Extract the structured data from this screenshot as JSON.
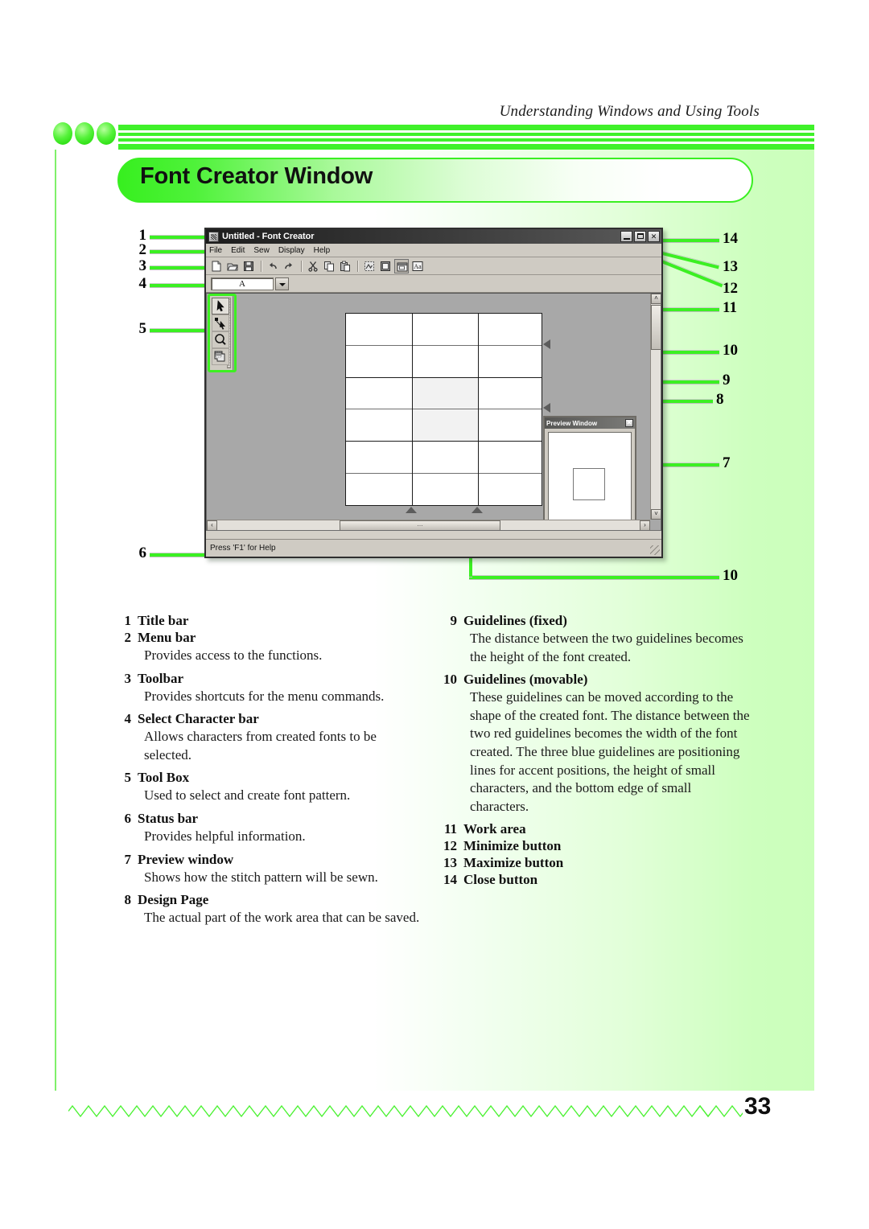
{
  "page": {
    "running_head": "Understanding Windows and Using Tools",
    "section_title": "Font Creator Window",
    "page_number": "33",
    "accent_color": "#3ff12a",
    "panel_gradient_end": "#cbffbb"
  },
  "app": {
    "title": "Untitled - Font Creator",
    "title_icon": "font-creator-app-icon",
    "window_buttons": [
      {
        "name": "minimize",
        "label": "–",
        "icon": "minimize-icon"
      },
      {
        "name": "maximize",
        "label": "□",
        "icon": "maximize-icon"
      },
      {
        "name": "close",
        "label": "✕",
        "icon": "close-icon"
      }
    ],
    "menus": [
      "File",
      "Edit",
      "Sew",
      "Display",
      "Help"
    ],
    "toolbar": [
      {
        "name": "new",
        "icon": "new-document-icon"
      },
      {
        "name": "open",
        "icon": "open-folder-icon"
      },
      {
        "name": "save",
        "icon": "save-disk-icon"
      },
      {
        "name": "sep1",
        "icon": "separator"
      },
      {
        "name": "undo",
        "icon": "undo-arrow-icon"
      },
      {
        "name": "redo",
        "icon": "redo-arrow-icon"
      },
      {
        "name": "sep2",
        "icon": "separator"
      },
      {
        "name": "cut",
        "icon": "scissors-icon"
      },
      {
        "name": "copy",
        "icon": "copy-icon"
      },
      {
        "name": "paste",
        "icon": "paste-icon"
      },
      {
        "name": "sep3",
        "icon": "separator"
      },
      {
        "name": "sew",
        "icon": "sew-icon"
      },
      {
        "name": "design-page-property",
        "icon": "design-page-icon"
      },
      {
        "name": "preview",
        "icon": "preview-icon"
      },
      {
        "name": "font-property",
        "icon": "font-aa-icon"
      }
    ],
    "select_character_bar": {
      "value": "A",
      "dropdown_icon": "chevron-down-icon"
    },
    "toolbox": [
      {
        "name": "select-tool",
        "icon": "arrow-pointer-icon",
        "active": true
      },
      {
        "name": "point-edit-tool",
        "icon": "point-edit-icon",
        "active": false
      },
      {
        "name": "zoom-tool",
        "icon": "magnifier-icon",
        "active": false
      },
      {
        "name": "pattern-tool",
        "icon": "pattern-stack-icon",
        "active": false
      }
    ],
    "preview_window": {
      "title": "Preview Window",
      "close_icon": "close-icon",
      "close_label": "✕"
    },
    "status_bar": "Press 'F1' for Help",
    "scrollbars": {
      "up_label": "˄",
      "down_label": "˅",
      "left_label": "‹",
      "right_label": "›",
      "grip_label": "⋯"
    }
  },
  "callouts": {
    "left": [
      "1",
      "2",
      "3",
      "4",
      "5",
      "6"
    ],
    "right": [
      "14",
      "13",
      "12",
      "11",
      "10",
      "9",
      "8",
      "7",
      "10"
    ]
  },
  "legend": {
    "left": [
      {
        "num": "1",
        "term": "Title bar",
        "desc": ""
      },
      {
        "num": "2",
        "term": "Menu bar",
        "desc": "Provides access to the functions."
      },
      {
        "num": "3",
        "term": "Toolbar",
        "desc": "Provides shortcuts for the menu commands."
      },
      {
        "num": "4",
        "term": "Select Character bar",
        "desc": "Allows characters from created fonts to be selected."
      },
      {
        "num": "5",
        "term": "Tool Box",
        "desc": "Used to select and create font pattern."
      },
      {
        "num": "6",
        "term": "Status bar",
        "desc": "Provides helpful information."
      },
      {
        "num": "7",
        "term": "Preview window",
        "desc": "Shows how the stitch pattern will be sewn."
      },
      {
        "num": "8",
        "term": "Design Page",
        "desc": "The actual part of the work area that can be saved."
      }
    ],
    "right": [
      {
        "num": "9",
        "term": "Guidelines (fixed)",
        "desc": "The distance between the two guidelines becomes the height of the font created."
      },
      {
        "num": "10",
        "term": "Guidelines (movable)",
        "desc": "These guidelines can be moved according to the shape of the created font. The distance between the two red guidelines becomes the width of the font created. The three blue guidelines are positioning lines for accent positions, the height of small characters, and the bottom edge of small characters."
      },
      {
        "num": "11",
        "term": "Work area",
        "desc": ""
      },
      {
        "num": "12",
        "term": "Minimize button",
        "desc": ""
      },
      {
        "num": "13",
        "term": "Maximize button",
        "desc": ""
      },
      {
        "num": "14",
        "term": "Close button",
        "desc": ""
      }
    ]
  }
}
